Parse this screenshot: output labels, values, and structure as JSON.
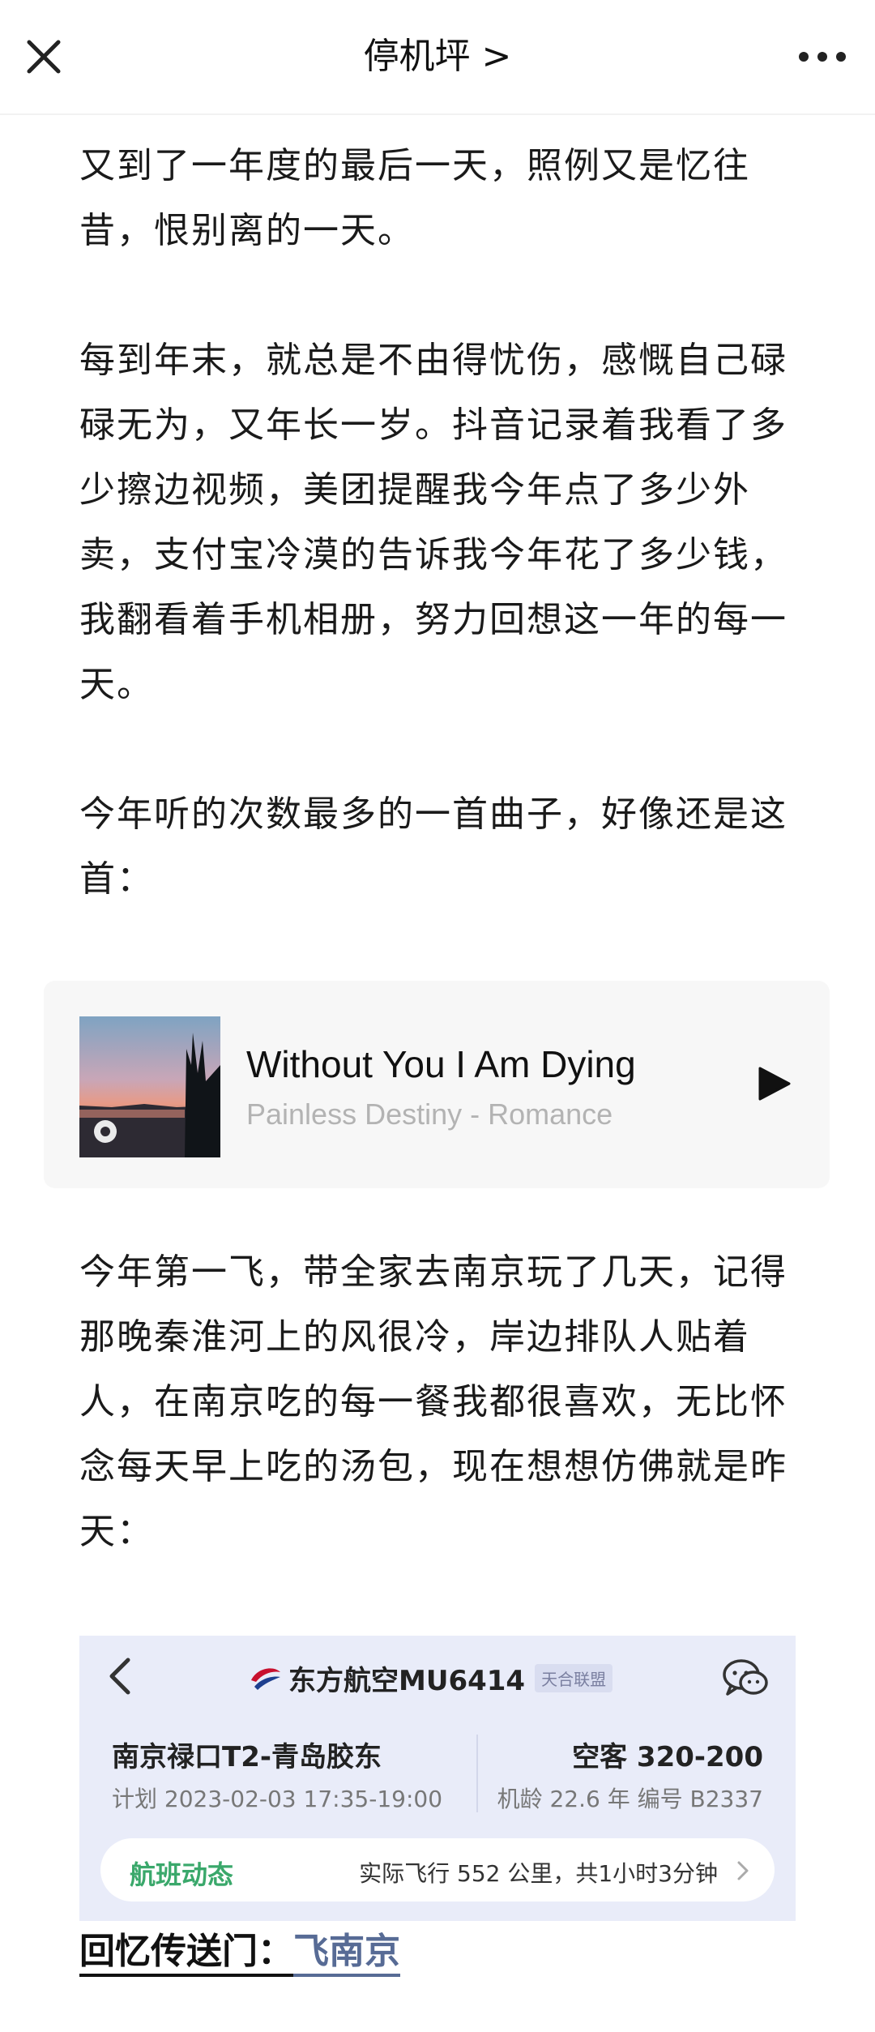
{
  "topbar": {
    "title": "停机坪 >",
    "close_icon": "close-icon",
    "more_icon": "more-icon"
  },
  "article": {
    "paragraphs": [
      "又到了一年度的最后一天，照例又是忆往昔，恨别离的一天。",
      "每到年末，就总是不由得忧伤，感慨自己碌碌无为，又年长一岁。抖音记录着我看了多少擦边视频，美团提醒我今年点了多少外卖，支付宝冷漠的告诉我今年花了多少钱，我翻看着手机相册，努力回想这一年的每一天。",
      "今年听的次数最多的一首曲子，好像还是这首：",
      "今年第一飞，带全家去南京玩了几天，记得那晚秦淮河上的风很冷，岸边排队人贴着人，在南京吃的每一餐我都很喜欢，无比怀念每天早上吃的汤包，现在想想仿佛就是昨天："
    ]
  },
  "music": {
    "title": "Without You I Am Dying",
    "artist": "Painless Destiny - Romance",
    "play_icon": "play-icon"
  },
  "flight": {
    "airline": "东方航空MU6414",
    "alliance": "天合联盟",
    "route": "南京禄口T2-青岛胶东",
    "plan": "计划 2023-02-03 17:35-19:00",
    "aircraft": "空客 320-200",
    "age": "机龄 22.6 年 编号 B2337",
    "dynamic_label": "航班动态",
    "flight_info": "实际飞行 552 公里，共1小时3分钟",
    "brand_color": "#c8102e",
    "accent_green": "#3aa86b"
  },
  "portal": {
    "label": "回忆传送门：",
    "link": "飞南京",
    "link_color": "#576b95"
  }
}
